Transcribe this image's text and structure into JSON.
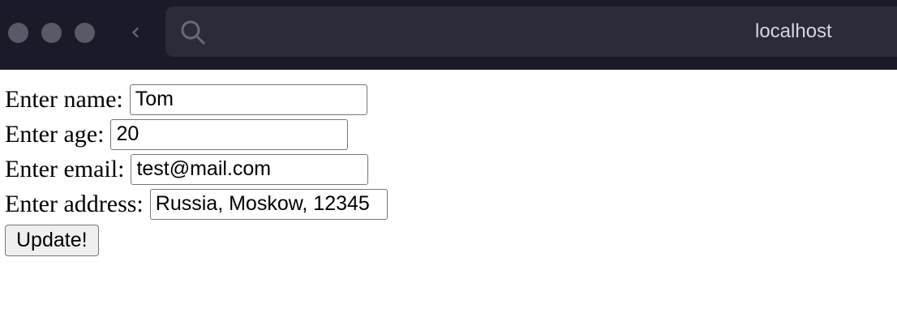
{
  "browser": {
    "url": "localhost",
    "traffic_light_color": "#5a5966"
  },
  "form": {
    "name": {
      "label": "Enter name:",
      "value": "Tom"
    },
    "age": {
      "label": "Enter age:",
      "value": "20"
    },
    "email": {
      "label": "Enter email:",
      "value": "test@mail.com"
    },
    "address": {
      "label": "Enter address:",
      "value": "Russia, Moskow, 12345"
    },
    "submit_label": "Update!"
  }
}
